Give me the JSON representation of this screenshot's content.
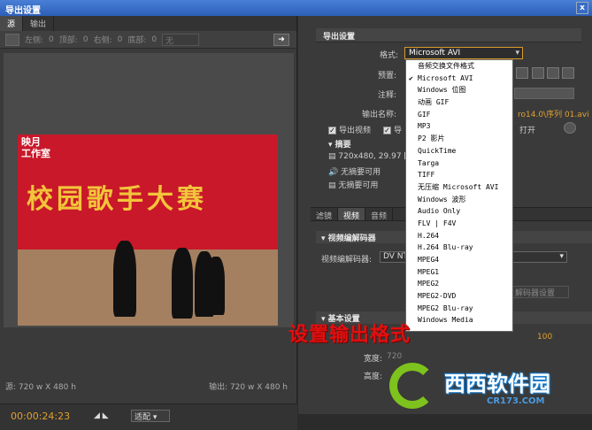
{
  "window": {
    "title": "导出设置",
    "close_label": "x"
  },
  "left": {
    "tabs": [
      "源",
      "输出"
    ],
    "crop": {
      "left_label": "左侧:",
      "left_val": "0",
      "top_label": "顶部:",
      "top_val": "0",
      "right_label": "右侧:",
      "right_val": "0",
      "bottom_label": "底部:",
      "bottom_val": "0",
      "preset": "无"
    },
    "video": {
      "logo_line1": "映月",
      "logo_line2": "工作室",
      "banner": "校园歌手大赛"
    },
    "source_size": "源: 720 w X 480 h",
    "output_size": "输出: 720 w X 480 h",
    "timecode": "00:00:24:23",
    "fit": "适配"
  },
  "right": {
    "section_title": "导出设置",
    "format_label": "格式:",
    "format_value": "Microsoft AVI",
    "preset_label": "预置:",
    "comment_label": "注释:",
    "output_name_label": "输出名称:",
    "output_name_value": "ro14.0\\序列 01.avi",
    "export_video_label": "导出视频",
    "export_audio_partial": "导",
    "open_label": "打开",
    "summary_label": "摘要",
    "summary_line1": "720x480, 29.97 [fp",
    "summary_line2": "无摘要可用",
    "summary_line3": "无摘要可用",
    "subtabs": [
      "滤镜",
      "视频",
      "音频"
    ],
    "video_codec_group": "视频编解码器",
    "video_codec_label": "视频编解码器:",
    "video_codec_value": "DV NT",
    "codec_settings_btn": "解码器设置",
    "basic_group": "基本设置",
    "width_label": "宽度:",
    "width_value": "720",
    "height_label": "高度:",
    "value_100": "100"
  },
  "dropdown": {
    "selected_index": 1,
    "items": [
      "音频交换文件格式",
      "Microsoft AVI",
      "Windows 位图",
      "动画 GIF",
      "GIF",
      "MP3",
      "P2 影片",
      "QuickTime",
      "Targa",
      "TIFF",
      "无压缩 Microsoft AVI",
      "Windows 波形",
      "Audio Only",
      "FLV | F4V",
      "H.264",
      "H.264 Blu-ray",
      "MPEG4",
      "MPEG1",
      "MPEG2",
      "MPEG2-DVD",
      "MPEG2 Blu-ray",
      "Windows Media"
    ]
  },
  "annotation": "设置输出格式",
  "watermark": {
    "main": "西西软件园",
    "sub": "CR173.COM"
  },
  "colors": {
    "accent": "#e0a030",
    "annotation": "#e01010",
    "watermark_green": "#7ec21e",
    "watermark_blue": "#1e7fd0"
  }
}
